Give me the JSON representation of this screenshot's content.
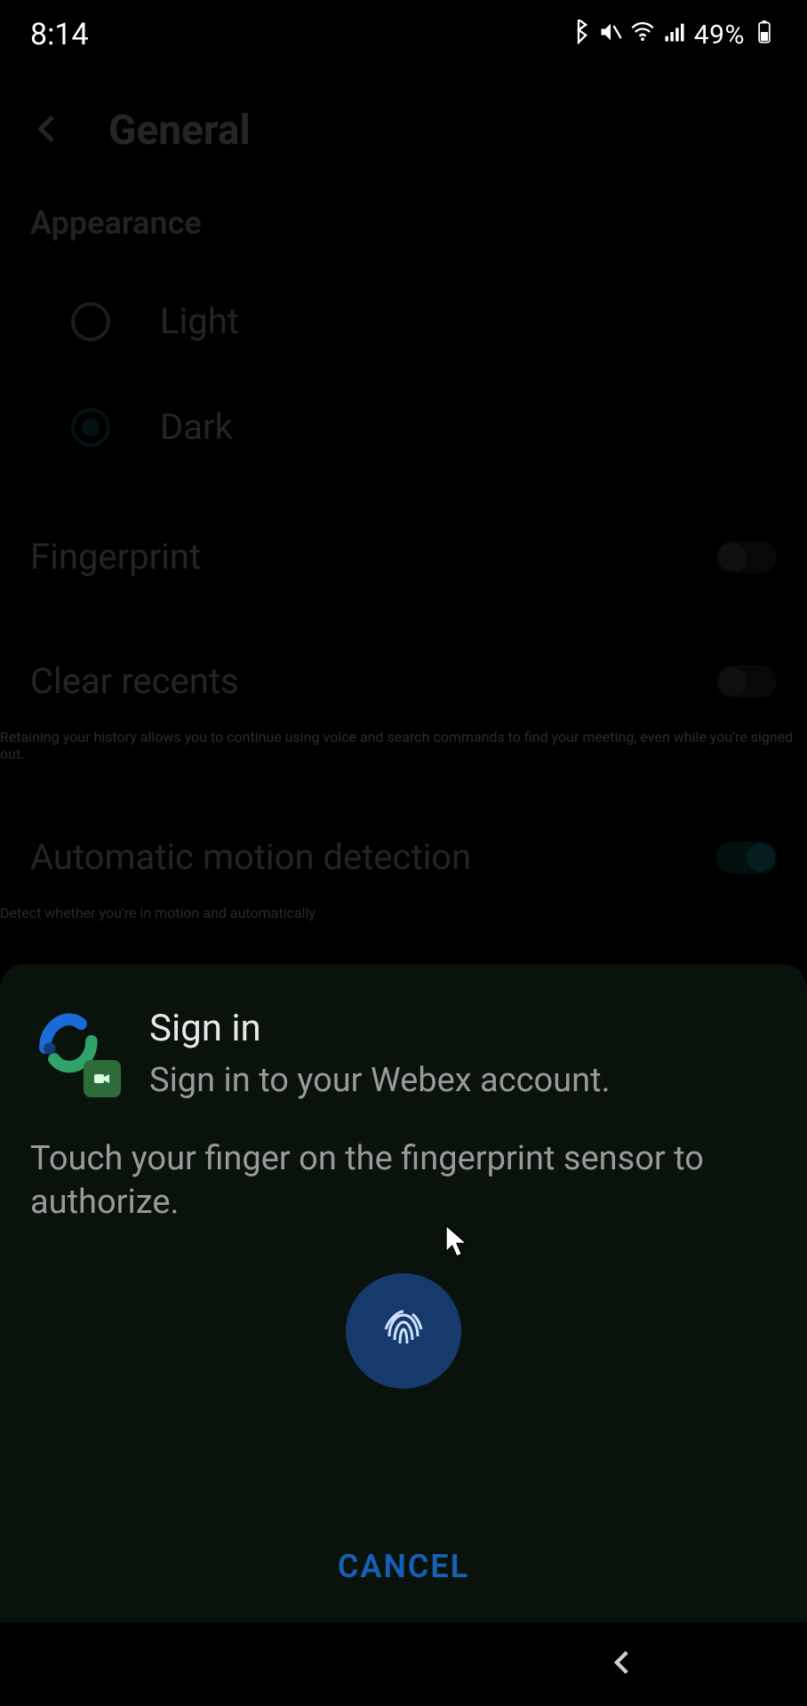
{
  "status": {
    "time": "8:14",
    "battery_pct": "49%"
  },
  "page": {
    "title": "General",
    "appearance": {
      "label": "Appearance",
      "options": {
        "light": "Light",
        "dark": "Dark"
      }
    },
    "fingerprint": {
      "title": "Fingerprint"
    },
    "clear_recents": {
      "title": "Clear recents",
      "desc": "Retaining your history allows you to continue using voice and search commands to find your meeting, even while you're signed out."
    },
    "motion": {
      "title": "Automatic motion detection",
      "desc": "Detect whether you're in motion and automatically"
    }
  },
  "modal": {
    "title": "Sign in",
    "subtitle": "Sign in to your Webex account.",
    "instruction": "Touch your finger on the fingerprint sensor to authorize.",
    "cancel": "CANCEL"
  }
}
